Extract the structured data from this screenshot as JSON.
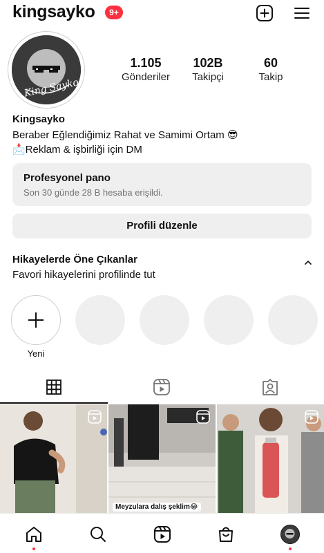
{
  "header": {
    "username": "kingsayko",
    "notification_count": "9+"
  },
  "profile": {
    "avatar_text": "King Sayko",
    "display_name": "Kingsayko",
    "bio": [
      "Beraber Eğlendiğimiz Rahat ve Samimi Ortam 😎",
      "📩Reklam & işbirliği için DM"
    ],
    "stats": [
      {
        "value": "1.105",
        "label": "Gönderiler"
      },
      {
        "value": "102B",
        "label": "Takipçi"
      },
      {
        "value": "60",
        "label": "Takip"
      }
    ]
  },
  "professional_dashboard": {
    "title": "Profesyonel pano",
    "subtitle": "Son 30 günde 28 B hesaba erişildi."
  },
  "edit_profile_label": "Profili düzenle",
  "highlights": {
    "title": "Hikayelerde Öne Çıkanlar",
    "subtitle": "Favori hikayelerini profilinde tut",
    "new_label": "Yeni"
  },
  "tabs": [
    {
      "icon": "grid-icon",
      "active": true
    },
    {
      "icon": "reels-icon",
      "active": false
    },
    {
      "icon": "tagged-icon",
      "active": false
    }
  ],
  "grid": [
    {
      "type": "reel",
      "caption": ""
    },
    {
      "type": "reel",
      "caption": "Meyzulara dalış şeklim😂"
    },
    {
      "type": "reel",
      "caption": ""
    }
  ],
  "bottom_nav": [
    {
      "icon": "home-icon",
      "badge": true
    },
    {
      "icon": "search-icon",
      "badge": false
    },
    {
      "icon": "reels-icon",
      "badge": false
    },
    {
      "icon": "shop-icon",
      "badge": false
    },
    {
      "icon": "profile-avatar",
      "badge": true
    }
  ],
  "colors": {
    "badge": "#ff3040",
    "panel_bg": "#efefef",
    "muted_text": "#737373"
  }
}
